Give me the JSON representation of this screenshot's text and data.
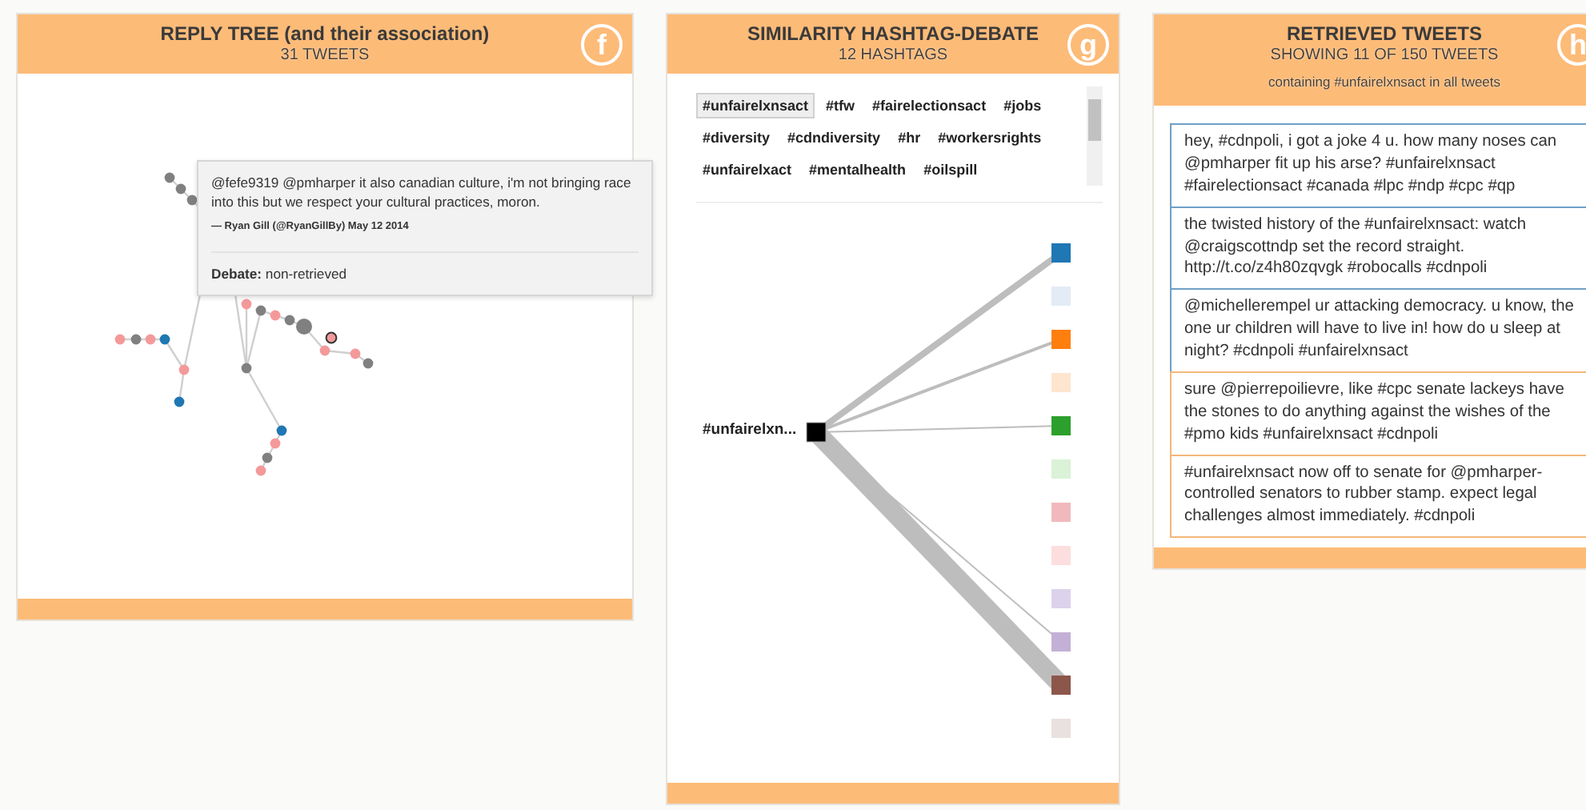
{
  "reply_tree": {
    "title": "REPLY TREE (and their association)",
    "subtitle": "31 TWEETS",
    "badge": "f",
    "nodes": [
      {
        "kind": "tweet",
        "color": "#808080",
        "selected": false
      },
      {
        "kind": "tweet",
        "color": "#808080",
        "selected": false
      },
      {
        "kind": "tweet",
        "color": "#808080",
        "selected": false
      },
      {
        "kind": "tweet",
        "color": "#f4999a",
        "selected": false
      },
      {
        "kind": "tweet",
        "color": "#808080",
        "selected": false
      },
      {
        "kind": "tweet",
        "color": "#f4999a",
        "selected": false
      },
      {
        "kind": "tweet",
        "color": "#1f77b4",
        "selected": false
      },
      {
        "kind": "tweet",
        "color": "#f4999a",
        "selected": false
      },
      {
        "kind": "tweet",
        "color": "#1f77b4",
        "selected": false
      },
      {
        "kind": "tweet",
        "color": "#f4999a",
        "selected": false
      },
      {
        "kind": "tweet",
        "color": "#808080",
        "selected": false
      },
      {
        "kind": "tweet",
        "color": "#f4999a",
        "selected": false
      },
      {
        "kind": "tweet",
        "color": "#808080",
        "selected": false
      },
      {
        "kind": "hub",
        "color": "#808080",
        "selected": false
      },
      {
        "kind": "tweet",
        "color": "#f4999a",
        "selected": true
      },
      {
        "kind": "tweet",
        "color": "#f4999a",
        "selected": false
      },
      {
        "kind": "tweet",
        "color": "#f4999a",
        "selected": false
      },
      {
        "kind": "tweet",
        "color": "#808080",
        "selected": false
      },
      {
        "kind": "tweet",
        "color": "#808080",
        "selected": false
      },
      {
        "kind": "tweet",
        "color": "#1f77b4",
        "selected": false
      },
      {
        "kind": "tweet",
        "color": "#f4999a",
        "selected": false
      },
      {
        "kind": "tweet",
        "color": "#808080",
        "selected": false
      },
      {
        "kind": "tweet",
        "color": "#f4999a",
        "selected": false
      }
    ],
    "tooltip": {
      "text": "@fefe9319 @pmharper it also canadian culture, i'm not bringing race into this but we respect your cultural practices, moron.",
      "attribution": "— Ryan Gill (@RyanGillBy) May 12 2014",
      "debate": "**Debate:** non-retrieved"
    }
  },
  "similarity": {
    "title": "SIMILARITY HASHTAG-DEBATE",
    "subtitle": "12 HASHTAGS",
    "badge": "g",
    "hashtags": [
      {
        "label": "#unfairelxnsact",
        "selected": true
      },
      {
        "label": "#tfw",
        "selected": false
      },
      {
        "label": "#fairelectionsact",
        "selected": false
      },
      {
        "label": "#jobs",
        "selected": false
      },
      {
        "label": "#diversity",
        "selected": false
      },
      {
        "label": "#cdndiversity",
        "selected": false
      },
      {
        "label": "#hr",
        "selected": false
      },
      {
        "label": "#workersrights",
        "selected": false
      },
      {
        "label": "#unfairelxact",
        "selected": false
      },
      {
        "label": "#mentalhealth",
        "selected": false
      },
      {
        "label": "#oilspill",
        "selected": false
      }
    ],
    "source_label": "#unfairelxn...",
    "targets": [
      {
        "color": "#1f77b4",
        "kind": "medium"
      },
      {
        "color": "#e3ebf6",
        "kind": "unlinked"
      },
      {
        "color": "#ff7f0e",
        "kind": "thin"
      },
      {
        "color": "#fde5d0",
        "kind": "unlinked"
      },
      {
        "color": "#2ca02c",
        "kind": "hair"
      },
      {
        "color": "#daf2d7",
        "kind": "unlinked"
      },
      {
        "color": "#f1b9bc",
        "kind": "unlinked"
      },
      {
        "color": "#fcdede",
        "kind": "unlinked"
      },
      {
        "color": "#ddd2ec",
        "kind": "unlinked"
      },
      {
        "color": "#c4b0d6",
        "kind": "hair"
      },
      {
        "color": "#8c564b",
        "kind": "strong"
      },
      {
        "color": "#e9e1df",
        "kind": "unlinked"
      }
    ]
  },
  "retrieved": {
    "title": "RETRIEVED TWEETS",
    "subtitle": "SHOWING 11 OF 150 TWEETS",
    "filter": "containing #unfairelxnsact in all tweets",
    "badge": "h",
    "tweets": [
      {
        "text": "hey, #cdnpoli, i got a joke 4 u. how many noses can @pmharper fit up his arse? #unfairelxnsact #fairelectionsact #canada #lpc #ndp #cpc #qp",
        "color": "#6f9fc6"
      },
      {
        "text": "the twisted history of the #unfairelxnsact: watch @craigscottndp set the record straight. http://t.co/z4h80zqvgk #robocalls #cdnpoli",
        "color": "#6f9fc6"
      },
      {
        "text": "@michellerempel ur attacking democracy. u know, the one ur children will have to live in! how do u sleep at night? #cdnpoli #unfairelxnsact",
        "color": "#6f9fc6"
      },
      {
        "text": "sure @pierrepoilievre, like #cpc senate lackeys have the stones to do anything against the wishes of the #pmo kids #unfairelxnsact #cdnpoli",
        "color": "#f3b778"
      },
      {
        "text": "#unfairelxnsact now off to senate for @pmharper-controlled senators to rubber stamp. expect legal challenges almost immediately. #cdnpoli",
        "color": "#f3b778"
      }
    ]
  }
}
